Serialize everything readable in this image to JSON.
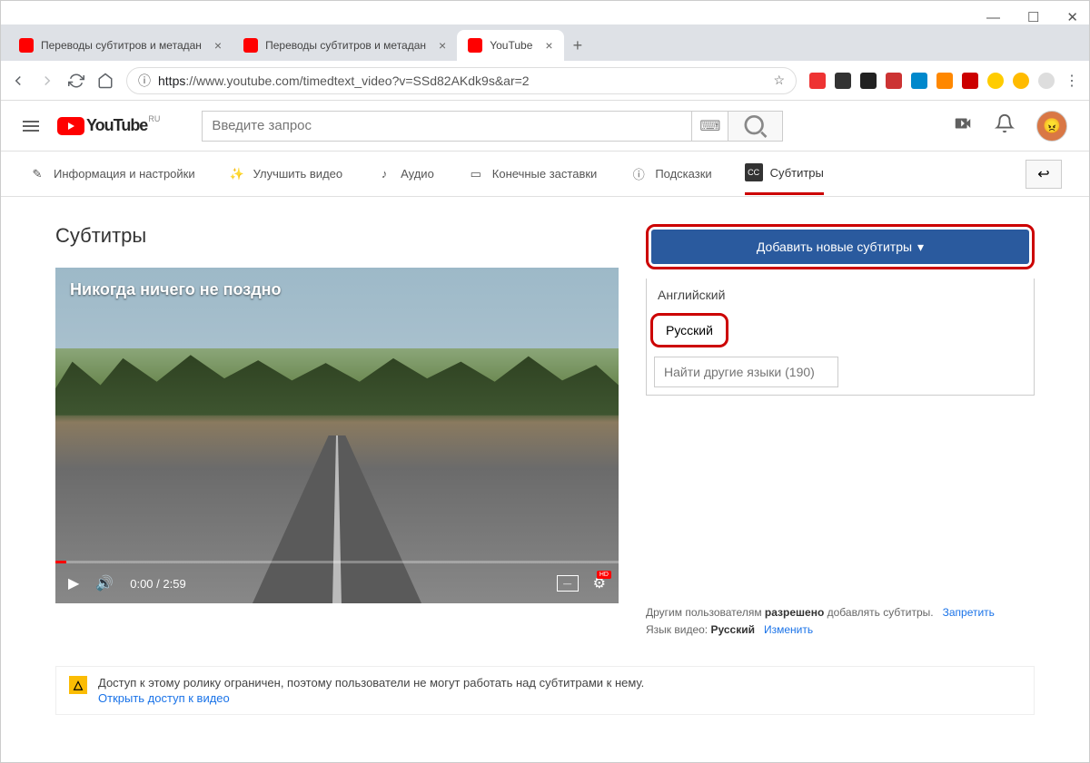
{
  "window": {
    "minimize": "—",
    "maximize": "☐",
    "close": "✕"
  },
  "tabs": {
    "t1": "Переводы субтитров и метадан",
    "t2": "Переводы субтитров и метадан",
    "t3": "YouTube",
    "new": "+"
  },
  "addrbar": {
    "prefix": "https",
    "url": "://www.youtube.com/timedtext_video?v=SSd82AKdk9s&ar=2"
  },
  "yt": {
    "brand": "YouTube",
    "region": "RU",
    "search_placeholder": "Введите запрос"
  },
  "studio_tabs": {
    "info": "Информация и настройки",
    "enhance": "Улучшить видео",
    "audio": "Аудио",
    "endscreens": "Конечные заставки",
    "cards": "Подсказки",
    "subtitles": "Субтитры"
  },
  "page": {
    "title": "Субтитры",
    "video_title": "Никогда ничего не поздно",
    "time": "0:00 / 2:59"
  },
  "panel": {
    "add_button": "Добавить новые субтитры",
    "lang_en": "Английский",
    "lang_ru": "Русский",
    "search_placeholder": "Найти другие языки (190)"
  },
  "footer": {
    "line1a": "Другим пользователям ",
    "line1b": "разрешено",
    "line1c": " добавлять субтитры.",
    "forbid": "Запретить",
    "line2a": "Язык видео: ",
    "lang": "Русский",
    "change": "Изменить"
  },
  "warning": {
    "text": "Доступ к этому ролику ограничен, поэтому пользователи не могут работать над субтитрами к нему.",
    "link": "Открыть доступ к видео"
  }
}
